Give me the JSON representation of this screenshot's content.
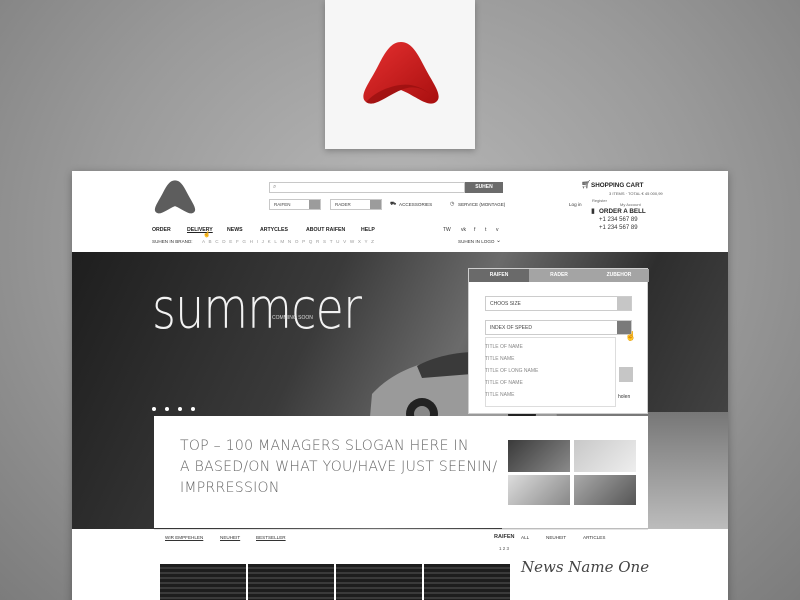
{
  "header": {
    "search_placeholder": "",
    "search_button": "SUHEN",
    "select_1": "RAIFEN",
    "select_2": "RADER",
    "accessories": "ACCESSORIES",
    "service": "SERVICE (MONTAGE)",
    "cart_title": "SHOPPING CART",
    "cart_summary": "3 ITEMS · TOTAL € 45 000,99",
    "login": "Log in",
    "register": "Register",
    "my_account": "My Account",
    "order_bell": "ORDER A BELL",
    "phone_1": "+1 234 567 89",
    "phone_2": "+1 234 567 89"
  },
  "nav": [
    "ORDER",
    "DELIVERY",
    "NEWS",
    "ARTYCLES",
    "ABOUT RAIFEN",
    "HELP"
  ],
  "social": [
    "TW",
    "vk",
    "f",
    "t",
    "v"
  ],
  "brand_bar": {
    "label": "SUHEN IN BRAND:",
    "letters": "A B C D E F G H I J K L M N O P Q R S T U V W X Y Z",
    "logo_label": "SUHEN IN LOGO"
  },
  "hero": {
    "title": "summcer",
    "subtitle": "COMMING SOON"
  },
  "panel": {
    "tabs": [
      "RAIFEN",
      "RADER",
      "ZUBEHOR"
    ],
    "choose_size": "CHOOS SIZE",
    "speed_index": "INDEX OF SPEED",
    "options": [
      "TITLE OF NAME",
      "TITLE NAME",
      "TITLE OF LONG NAME",
      "TITLE OF NAME",
      "TITLE NAME"
    ],
    "side_text": "holen"
  },
  "content": {
    "slogan_1": "TOP – 100 MANAGERS SLOGAN HERE IN",
    "slogan_2": "A BASED/ON WHAT YOU/HAVE JUST SEENIN/",
    "slogan_3": "IMPRRESSION"
  },
  "filters": {
    "left": [
      "WIR EMPFEHLEN",
      "NEUHEIT",
      "BESTSELLER"
    ],
    "right_title": "RAIFEN",
    "right": [
      "ALL",
      "NEUHEIT",
      "ARTICLES"
    ],
    "pages": "1 2 3"
  },
  "news_title": "News Name One",
  "colors": {
    "brand_red": "#d21a1a",
    "search_btn": "#6b6b6b",
    "tab_active": "#6a6a6a"
  }
}
